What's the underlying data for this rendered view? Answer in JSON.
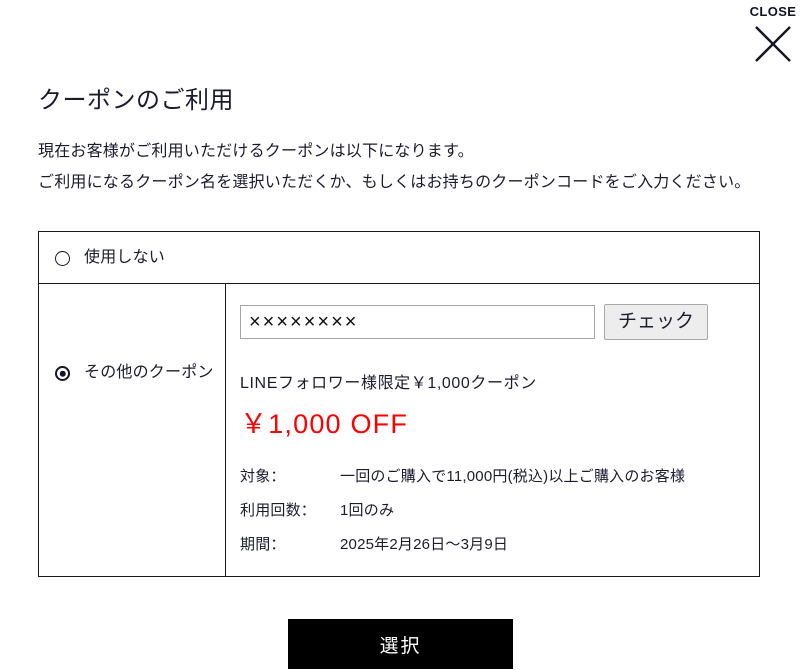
{
  "close": {
    "label": "CLOSE",
    "icon": "close-x-icon"
  },
  "heading": {
    "title": "クーポンのご利用",
    "lead_line_1": "現在お客様がご利用いただけるクーポンは以下になります。",
    "lead_line_2": "ご利用になるクーポン名を選択いただくか、もしくはお持ちのクーポンコードをご入力ください。"
  },
  "options": [
    {
      "id": "no-use",
      "label": "使用しない",
      "selected": false
    },
    {
      "id": "other-coupon",
      "label": "その他のクーポン",
      "selected": true
    }
  ],
  "code_entry": {
    "value": "××××××××",
    "placeholder": "",
    "check_button_label": "チェック"
  },
  "coupon": {
    "name": "LINEフォロワー様限定￥1,000クーポン",
    "amount": "￥1,000 OFF",
    "amount_color": "#fe0000",
    "specs": [
      {
        "key": "対象：",
        "value": "一回のご購入で11,000円(税込)以上ご購入のお客様"
      },
      {
        "key": "利用回数：",
        "value": "1回のみ"
      },
      {
        "key": "期間：",
        "value": "2025年2月26日〜3月9日"
      }
    ]
  },
  "submit": {
    "label": "選択"
  }
}
